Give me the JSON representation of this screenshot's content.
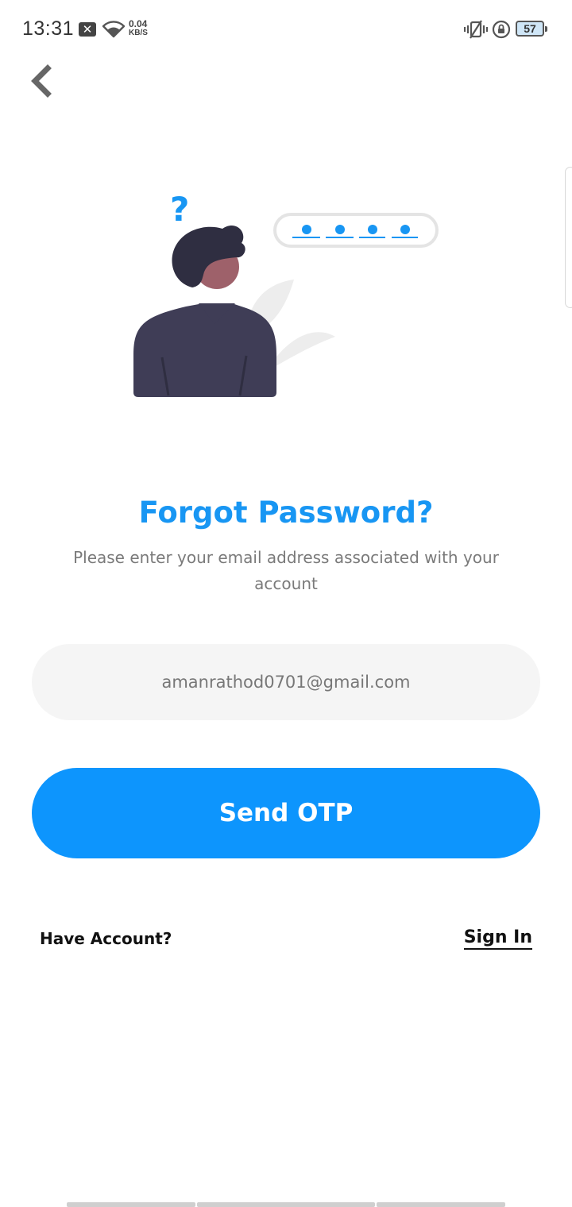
{
  "status_bar": {
    "time": "13:31",
    "notification_icon": "x-box-icon",
    "net_speed_value": "0.04",
    "net_speed_unit": "KB/S",
    "battery_level": "57"
  },
  "header": {
    "back_icon": "chevron-left-icon"
  },
  "illustration": {
    "question_mark": "?",
    "accent_color": "#1896f3"
  },
  "main": {
    "title": "Forgot Password?",
    "subtitle": "Please enter your email address associated with your account",
    "email_value": "amanrathod0701@gmail.com",
    "send_button_label": "Send OTP"
  },
  "footer": {
    "have_account_label": "Have Account?",
    "sign_in_label": "Sign In"
  },
  "colors": {
    "primary": "#0d95fd",
    "title": "#1896f3",
    "field_background": "#f5f5f5"
  }
}
